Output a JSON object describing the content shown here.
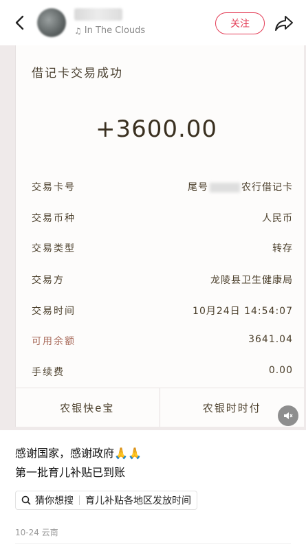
{
  "header": {
    "music_title": "In The Clouds",
    "follow_label": "关注"
  },
  "receipt": {
    "title": "借记卡交易成功",
    "amount": "+3600.00",
    "rows": [
      {
        "key": "交易卡号",
        "value_prefix": "尾号",
        "value_suffix": "农行借记卡"
      },
      {
        "key": "交易币种",
        "value": "人民币"
      },
      {
        "key": "交易类型",
        "value": "转存"
      },
      {
        "key": "交易方",
        "value": "龙陵县卫生健康局"
      },
      {
        "key": "交易时间",
        "value": "10月24日 14:54:07"
      },
      {
        "key": "可用余额",
        "value": "3641.04"
      },
      {
        "key": "手续费",
        "value": "0.00"
      }
    ],
    "buttons": [
      "农银快e宝",
      "农银时时付"
    ]
  },
  "caption": {
    "line1": "感谢国家，感谢政府",
    "emoji": "🙏🙏",
    "line2": "第一批育儿补贴已到账"
  },
  "search": {
    "label": "猜你想搜",
    "query": "育儿补贴各地区发放时间"
  },
  "meta": "10-24 云南",
  "colors": {
    "accent": "#e33b55"
  }
}
